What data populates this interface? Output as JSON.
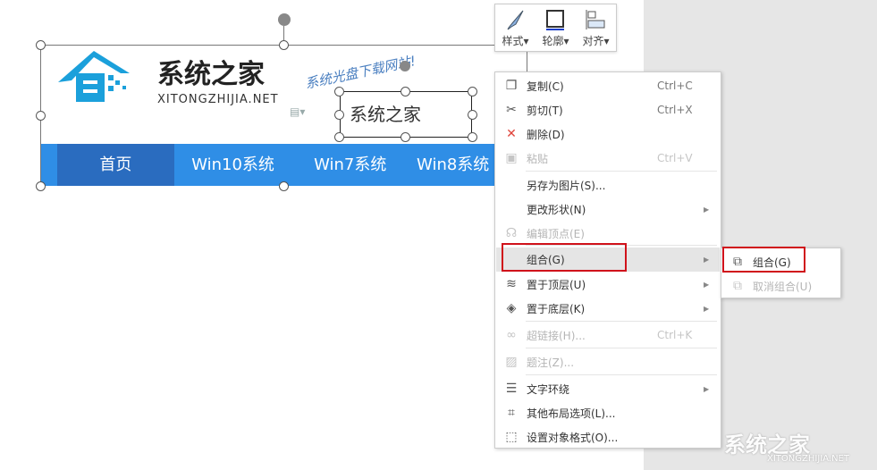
{
  "banner": {
    "logo_title": "系统之家",
    "logo_domain": "XITONGZHIJIA.NET",
    "slogan": "系统光盘下载网站!",
    "textbox": "系统之家",
    "nav": [
      "首页",
      "Win10系统",
      "Win7系统",
      "Win8系统"
    ]
  },
  "toolbar": {
    "style": "样式",
    "outline": "轮廓",
    "align": "对齐"
  },
  "menu": [
    {
      "label": "复制(C)",
      "shortcut": "Ctrl+C",
      "icon": "copy-icon"
    },
    {
      "label": "剪切(T)",
      "shortcut": "Ctrl+X",
      "icon": "cut-icon"
    },
    {
      "label": "删除(D)",
      "shortcut": "",
      "icon": "delete-icon"
    },
    {
      "label": "粘贴",
      "shortcut": "Ctrl+V",
      "icon": "paste-icon"
    },
    {
      "label": "另存为图片(S)...",
      "shortcut": ""
    },
    {
      "label": "更改形状(N)",
      "shortcut": ""
    },
    {
      "label": "编辑顶点(E)",
      "shortcut": ""
    },
    {
      "label": "组合(G)",
      "shortcut": ""
    },
    {
      "label": "置于顶层(U)",
      "shortcut": ""
    },
    {
      "label": "置于底层(K)",
      "shortcut": ""
    },
    {
      "label": "超链接(H)...",
      "shortcut": "Ctrl+K"
    },
    {
      "label": "题注(Z)...",
      "shortcut": ""
    },
    {
      "label": "文字环绕",
      "shortcut": ""
    },
    {
      "label": "其他布局选项(L)...",
      "shortcut": ""
    },
    {
      "label": "设置对象格式(O)...",
      "shortcut": ""
    }
  ],
  "submenu": [
    {
      "label": "组合(G)"
    },
    {
      "label": "取消组合(U)"
    }
  ],
  "watermark": {
    "title": "系统之家",
    "domain": "XITONGZHIJIA.NET"
  },
  "colors": {
    "accent": "#2f8ee6",
    "highlight": "#d0121b"
  }
}
